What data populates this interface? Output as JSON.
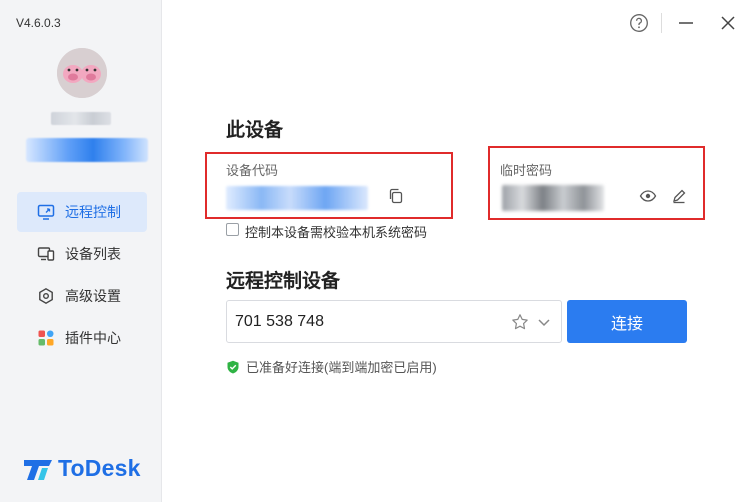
{
  "app": {
    "version": "V4.6.0.3",
    "brand_name": "ToDesk",
    "brand_color": "#1f6fe5"
  },
  "sidebar": {
    "items": [
      {
        "label": "远程控制",
        "icon": "monitor-remote-icon",
        "active": true
      },
      {
        "label": "设备列表",
        "icon": "devices-icon",
        "active": false
      },
      {
        "label": "高级设置",
        "icon": "settings-hex-icon",
        "active": false
      },
      {
        "label": "插件中心",
        "icon": "plugins-grid-icon",
        "active": false
      }
    ]
  },
  "window_controls": [
    "help-icon",
    "minimize-icon",
    "close-icon"
  ],
  "this_device": {
    "title": "此设备",
    "device_code_label": "设备代码",
    "temp_password_label": "临时密码",
    "require_password_label": "控制本设备需校验本机系统密码"
  },
  "remote": {
    "title": "远程控制设备",
    "input_value": "701 538 748",
    "connect_label": "连接",
    "status_text": "已准备好连接(端到端加密已启用)",
    "status_color": "#2fb344"
  },
  "colors": {
    "accent": "#2b7cf0",
    "highlight_box": "#e02b2b"
  }
}
